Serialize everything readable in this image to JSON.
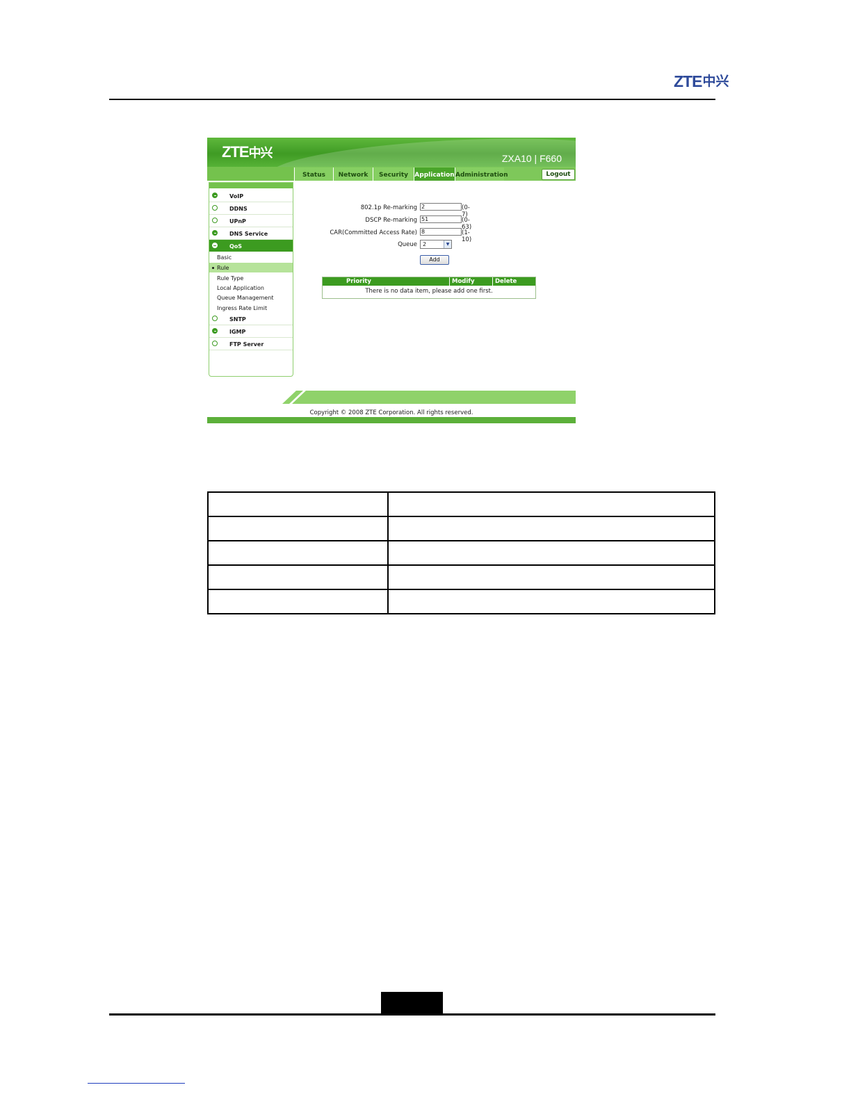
{
  "document": {
    "logo": {
      "latin": "ZTE",
      "cjk": "中兴"
    }
  },
  "screenshot": {
    "banner": {
      "brand_latin": "ZTE",
      "brand_cjk": "中兴",
      "model": "ZXA10 | F660"
    },
    "tabs": [
      {
        "label": "Status"
      },
      {
        "label": "Network"
      },
      {
        "label": "Security"
      },
      {
        "label": "Application",
        "active": true
      },
      {
        "label": "Administration"
      }
    ],
    "logout_label": "Logout",
    "sidebar": {
      "items": [
        {
          "label": "VoIP",
          "icon": "plus-circle-icon"
        },
        {
          "label": "DDNS",
          "icon": "circle-icon"
        },
        {
          "label": "UPnP",
          "icon": "circle-icon"
        },
        {
          "label": "DNS Service",
          "icon": "plus-circle-icon"
        },
        {
          "label": "QoS",
          "icon": "minus-circle-icon",
          "active": true
        },
        {
          "label": "SNTP",
          "icon": "circle-icon"
        },
        {
          "label": "IGMP",
          "icon": "plus-circle-icon"
        },
        {
          "label": "FTP Server",
          "icon": "circle-icon"
        }
      ],
      "qos_subitems": [
        {
          "label": "Basic"
        },
        {
          "label": "Rule",
          "selected": true
        },
        {
          "label": "Rule Type"
        },
        {
          "label": "Local Application"
        },
        {
          "label": "Queue Management"
        },
        {
          "label": "Ingress Rate Limit"
        }
      ]
    },
    "form": {
      "dot1p": {
        "label": "802.1p Re-marking",
        "value": "2",
        "range": "(0-7)"
      },
      "dscp": {
        "label": "DSCP Re-marking",
        "value": "51",
        "range": "(0-63)"
      },
      "car": {
        "label": "CAR(Committed Access Rate)",
        "value": "8",
        "range": "(1-10)"
      },
      "queue": {
        "label": "Queue",
        "value": "2"
      },
      "add_label": "Add"
    },
    "rule_table": {
      "headers": [
        "Priority",
        "Modify",
        "Delete"
      ],
      "empty_message": "There is no data item, please add one first."
    },
    "copyright": "Copyright © 2008 ZTE Corporation. All rights reserved."
  },
  "colors": {
    "zte_blue": "#2e4a9a",
    "router_green": "#3c9b20",
    "router_light_green": "#8fd26a"
  }
}
